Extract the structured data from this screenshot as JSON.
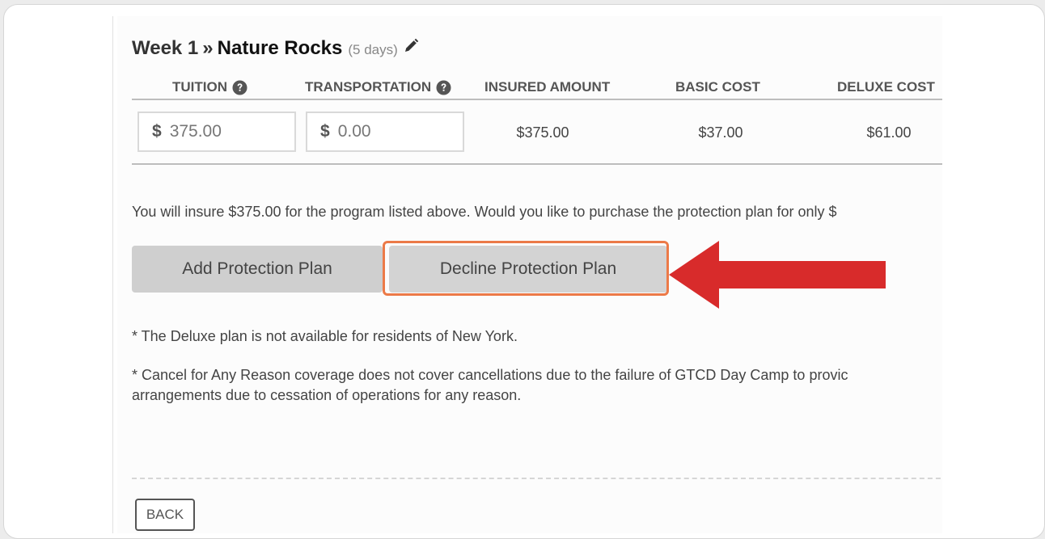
{
  "header": {
    "week": "Week 1",
    "separator": "»",
    "program_name": "Nature Rocks",
    "days": "(5 days)",
    "edit_icon": "pencil-icon"
  },
  "table": {
    "columns": {
      "tuition": "TUITION",
      "transportation": "TRANSPORTATION",
      "insured_amount": "INSURED AMOUNT",
      "basic_cost": "BASIC COST",
      "deluxe_cost": "DELUXE COST"
    },
    "help_icon": "question-circle-icon",
    "row": {
      "currency_symbol": "$",
      "tuition_value": "375.00",
      "transportation_value": "0.00",
      "insured_amount": "$375.00",
      "basic_cost": "$37.00",
      "deluxe_cost": "$61.00"
    }
  },
  "message": "You will insure $375.00 for the program listed above. Would you like to purchase the protection plan for only $",
  "buttons": {
    "add": "Add Protection Plan",
    "decline": "Decline Protection Plan",
    "back": "BACK"
  },
  "notes": {
    "deluxe": "* The Deluxe plan is not available for residents of New York.",
    "cancel_line1": "* Cancel for Any Reason coverage does not cover cancellations due to the failure of GTCD Day Camp to provic",
    "cancel_line2": "arrangements due to cessation of operations for any reason."
  },
  "annotation": {
    "highlight_color": "#ec7a48",
    "arrow_color": "#d82b2b",
    "arrow_icon": "left-arrow-icon"
  }
}
